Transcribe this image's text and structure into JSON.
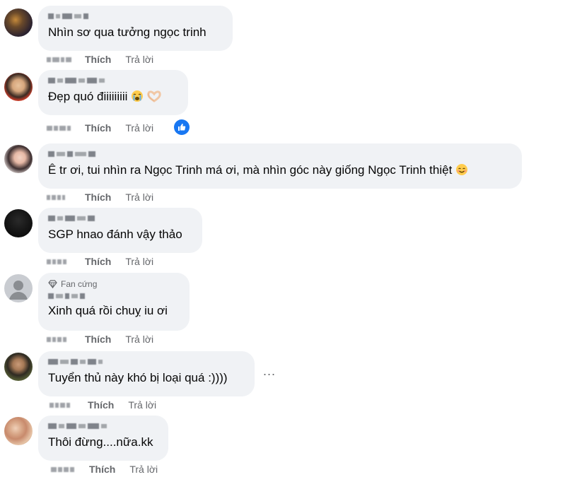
{
  "actions": {
    "like_label": "Thích",
    "reply_label": "Trả lời"
  },
  "comments": [
    {
      "text": "Nhìn sơ qua tưởng ngọc trinh",
      "avatar": "avatar-night-lights"
    },
    {
      "text": "Đẹp quó điiiiiiiii",
      "emojis": [
        "crying-face-emoji",
        "heart-hands-emoji"
      ],
      "reaction": "like-icon",
      "avatar": "avatar-man-glasses"
    },
    {
      "text": "Ê tr ơi, tui nhìn ra Ngọc Trinh má ơi, mà nhìn góc này giống Ngọc Trinh thiệt",
      "emojis": [
        "smiling-face-emoji"
      ],
      "avatar": "avatar-woman"
    },
    {
      "text": "SGP hnao đánh vậy thảo",
      "avatar": "avatar-dark"
    },
    {
      "badge": "Fan cứng",
      "text": "Xinh quá rồi chuỵ iu ơi",
      "avatar": "avatar-default"
    },
    {
      "text": "Tuyển thủ này khó bị loại quá :))))",
      "more": "...",
      "avatar": "avatar-man-outdoor"
    },
    {
      "text": "Thôi đừng....nữa.kk",
      "avatar": "avatar-food"
    }
  ]
}
